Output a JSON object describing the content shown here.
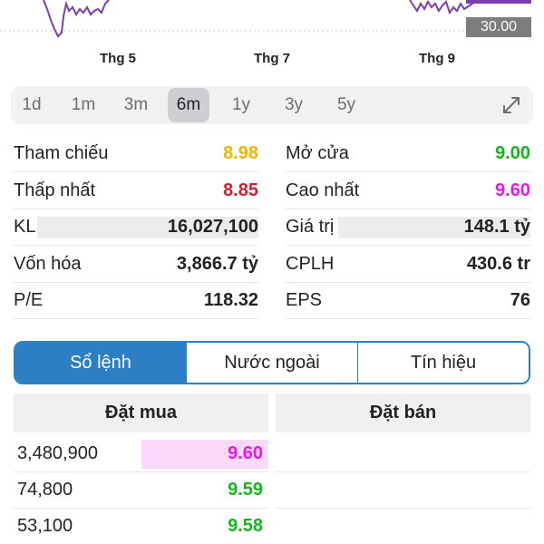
{
  "chart": {
    "price_tag": "30.00",
    "x_axis_labels": [
      "Thg 5",
      "Thg 7",
      "Thg 9"
    ],
    "line_color": "#7a3fb0"
  },
  "range": {
    "tabs": [
      "1d",
      "1m",
      "3m",
      "6m",
      "1y",
      "3y",
      "5y"
    ],
    "active": "6m",
    "expand_icon": "expand-icon"
  },
  "stats": {
    "rows": [
      {
        "left": {
          "label": "Tham chiếu",
          "value": "8.98",
          "color": "#f0b400"
        },
        "right": {
          "label": "Mở cửa",
          "value": "9.00",
          "color": "#18b41e"
        }
      },
      {
        "left": {
          "label": "Thấp nhất",
          "value": "8.85",
          "color": "#d11f2d"
        },
        "right": {
          "label": "Cao nhất",
          "value": "9.60",
          "color": "#e619e6"
        }
      },
      {
        "left": {
          "label": "KL",
          "value": "16,027,100"
        },
        "right": {
          "label": "Giá trị",
          "value": "148.1 tỷ"
        }
      },
      {
        "left": {
          "label": "Vốn hóa",
          "value": "3,866.7 tỷ"
        },
        "right": {
          "label": "CPLH",
          "value": "430.6 tr"
        }
      },
      {
        "left": {
          "label": "P/E",
          "value": "118.32"
        },
        "right": {
          "label": "EPS",
          "value": "76"
        }
      }
    ]
  },
  "segment": {
    "tabs": [
      "Sổ lệnh",
      "Nước ngoài",
      "Tín hiệu"
    ],
    "active": "Sổ lệnh"
  },
  "orderbook": {
    "bid_header": "Đặt mua",
    "ask_header": "Đặt bán",
    "bids": [
      {
        "volume": "3,480,900",
        "price": "9.60",
        "color": "#e619e6",
        "bg": "#fbd9fb"
      },
      {
        "volume": "74,800",
        "price": "9.59",
        "color": "#18b41e",
        "bg": ""
      },
      {
        "volume": "53,100",
        "price": "9.58",
        "color": "#18b41e",
        "bg": ""
      }
    ]
  }
}
